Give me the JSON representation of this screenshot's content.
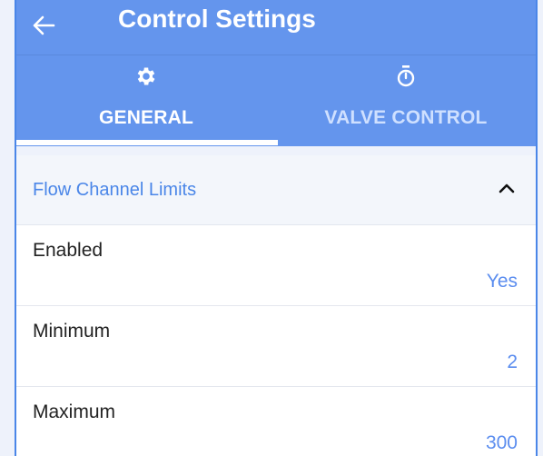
{
  "header": {
    "title": "Control Settings",
    "back_icon": "arrow-left-icon"
  },
  "tabs": [
    {
      "label": "GENERAL",
      "icon": "gear-icon",
      "active": true
    },
    {
      "label": "VALVE CONTROL",
      "icon": "stopwatch-icon",
      "active": false
    }
  ],
  "section": {
    "title": "Flow Channel Limits",
    "toggle_icon": "chevron-up-icon"
  },
  "rows": [
    {
      "label": "Enabled",
      "value": "Yes"
    },
    {
      "label": "Minimum",
      "value": "2"
    },
    {
      "label": "Maximum",
      "value": "300"
    }
  ],
  "colors": {
    "app_bar": "#6495ed",
    "accent_text": "#5b8def",
    "section_title": "#4a86e8"
  }
}
